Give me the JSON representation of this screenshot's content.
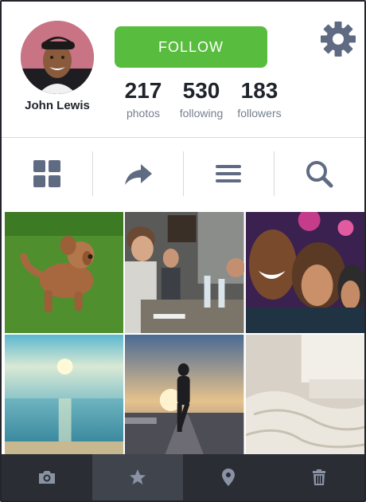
{
  "profile": {
    "name": "John Lewis",
    "follow_label": "FOLLOW",
    "stats": [
      {
        "value": "217",
        "label": "photos"
      },
      {
        "value": "530",
        "label": "following"
      },
      {
        "value": "183",
        "label": "followers"
      }
    ]
  },
  "toolbar": {
    "items": [
      "grid-view-icon",
      "share-icon",
      "list-view-icon",
      "search-icon"
    ]
  },
  "photos": [
    "dog-on-grass",
    "friends-dining",
    "friends-selfie",
    "sunset-sea",
    "runner-at-sunset",
    "unmade-bed"
  ],
  "bottom_bar": {
    "items": [
      "camera-icon",
      "star-icon",
      "location-pin-icon",
      "trash-icon"
    ],
    "active_index": 1
  },
  "colors": {
    "follow_green": "#58bd3e",
    "icon_slate": "#5f6b82",
    "bottom_bar": "#2a2d33",
    "bottom_bar_active": "#40444c"
  }
}
